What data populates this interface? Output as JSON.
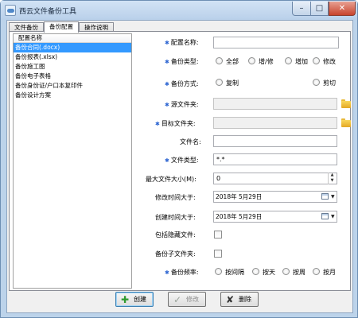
{
  "window": {
    "title": "西云文件备份工具",
    "controls": {
      "minimize": "–",
      "maximize": "□",
      "close": "✕"
    }
  },
  "tabs": [
    {
      "label": "文件备份",
      "active": false
    },
    {
      "label": "备份配置",
      "active": true
    },
    {
      "label": "操作说明",
      "active": false
    }
  ],
  "config_list": {
    "header": "配置名称",
    "items": [
      {
        "label": "备份合同(.docx)",
        "selected": true
      },
      {
        "label": "备份报表(.xlsx)",
        "selected": false
      },
      {
        "label": "备份施工图",
        "selected": false
      },
      {
        "label": "备份电子表格",
        "selected": false
      },
      {
        "label": "备份身份证/户口本复印件",
        "selected": false
      },
      {
        "label": "备份设计方案",
        "selected": false
      }
    ]
  },
  "form": {
    "config_name": {
      "label": "配置名称:",
      "value": ""
    },
    "backup_type": {
      "label": "备份类型:",
      "options": [
        "全部",
        "增/修",
        "增加",
        "修改"
      ]
    },
    "backup_method": {
      "label": "备份方式:",
      "options": [
        "复制",
        "剪切"
      ]
    },
    "source_folder": {
      "label": "源文件夹:",
      "value": "",
      "icon": "folder-icon"
    },
    "target_folder": {
      "label": "目标文件夹:",
      "value": "",
      "icon": "folder-icon"
    },
    "file_name": {
      "label": "文件名:",
      "value": ""
    },
    "file_type": {
      "label": "文件类型:",
      "value": "*.*"
    },
    "max_file_size": {
      "label": "最大文件大小(M):",
      "value": "0"
    },
    "modified_after": {
      "label": "修改时间大于:",
      "value": "2018年 5月29日"
    },
    "created_after": {
      "label": "创建时间大于:",
      "value": "2018年 5月29日"
    },
    "include_hidden": {
      "label": "包括隐藏文件:",
      "checked": false
    },
    "backup_subfolders": {
      "label": "备份子文件夹:",
      "checked": false
    },
    "backup_frequency": {
      "label": "备份频率:",
      "options": [
        "按间隔",
        "按天",
        "按周",
        "按月"
      ]
    }
  },
  "buttons": {
    "create": {
      "label": "创建",
      "enabled": true
    },
    "modify": {
      "label": "修改",
      "enabled": false
    },
    "delete": {
      "label": "删除",
      "enabled": true
    }
  },
  "colors": {
    "selection": "#3399ff",
    "required_marker": "#2a63d1",
    "create_icon": "#2f9a2f",
    "delete_icon": "#333333"
  }
}
